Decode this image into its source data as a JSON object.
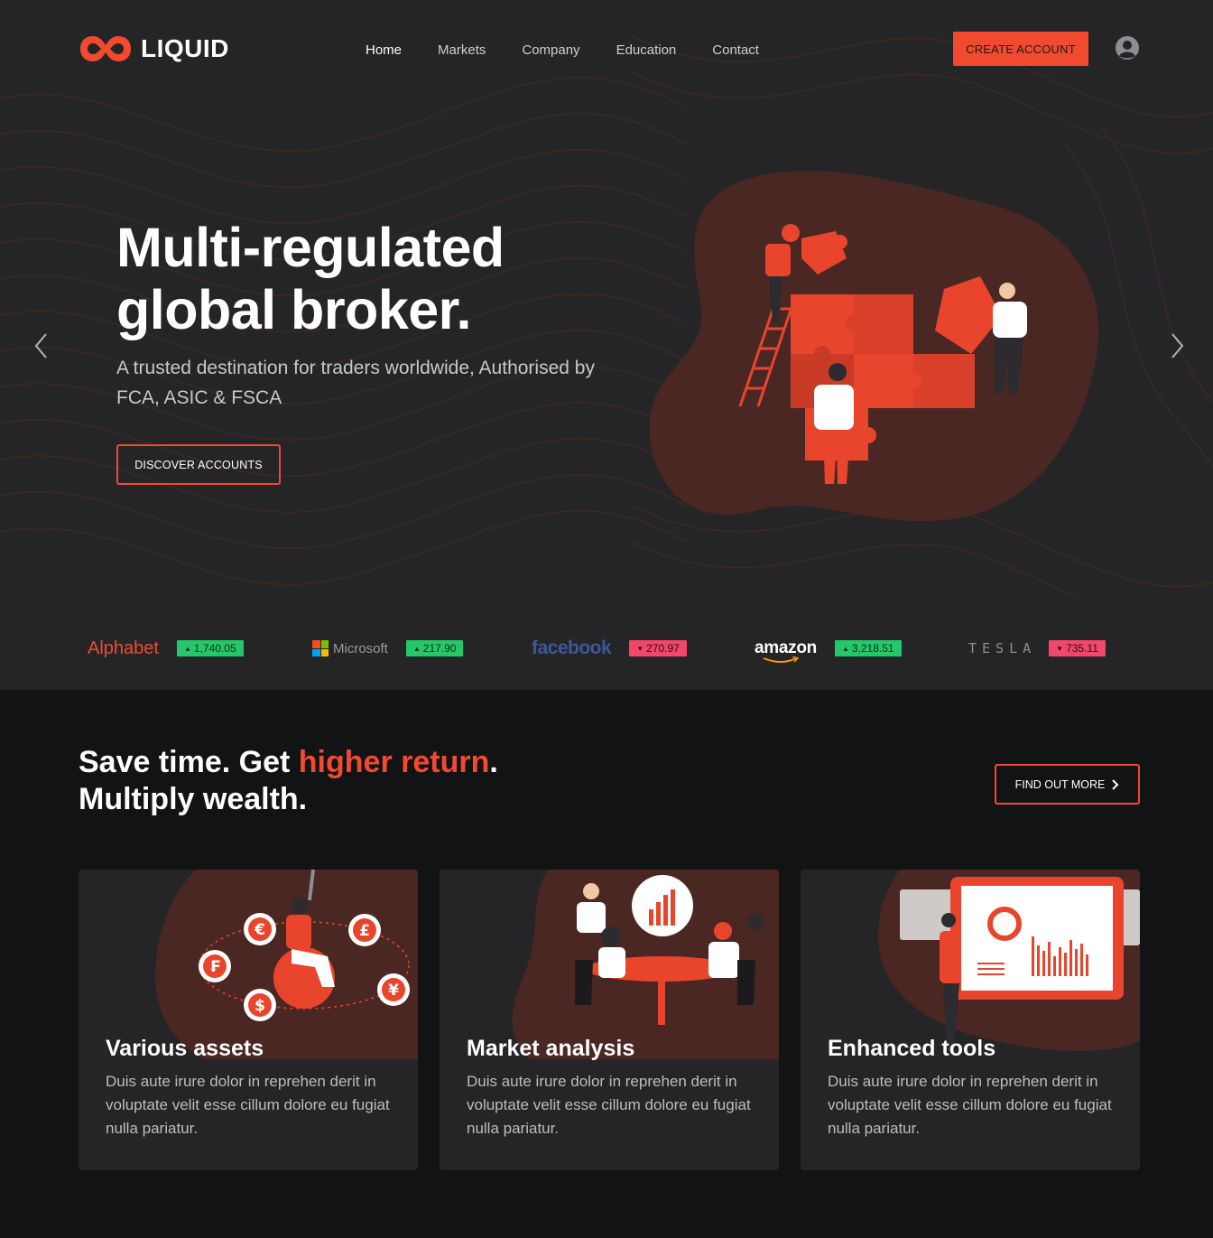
{
  "brand": {
    "name": "LIQUID",
    "accent": "#f24a2f"
  },
  "nav": {
    "links": [
      "Home",
      "Markets",
      "Company",
      "Education",
      "Contact"
    ],
    "active": "Home",
    "create_account": "CREATE ACCOUNT"
  },
  "hero": {
    "title_line1": "Multi-regulated",
    "title_line2": "global broker.",
    "subtitle": "A trusted destination for traders worldwide, Authorised by FCA, ASIC & FSCA",
    "cta": "DISCOVER ACCOUNTS"
  },
  "ticker": [
    {
      "company": "Alphabet",
      "value": "1,740.05",
      "direction": "up"
    },
    {
      "company": "Microsoft",
      "value": "217.90",
      "direction": "up"
    },
    {
      "company": "facebook",
      "value": "270.97",
      "direction": "down"
    },
    {
      "company": "amazon",
      "value": "3,218.51",
      "direction": "up"
    },
    {
      "company": "TESLA",
      "value": "735.11",
      "direction": "down"
    }
  ],
  "section": {
    "title_part1": "Save time. Get ",
    "title_highlight": "higher return",
    "title_part2": ".",
    "title_line2": "Multiply wealth.",
    "cta": "FIND OUT MORE"
  },
  "cards": [
    {
      "title": "Various assets",
      "text": "Duis aute irure dolor in reprehen derit in voluptate velit esse cillum dolore eu fugiat nulla pariatur."
    },
    {
      "title": "Market analysis",
      "text": "Duis aute irure dolor in reprehen derit in voluptate velit esse cillum dolore eu fugiat nulla pariatur."
    },
    {
      "title": "Enhanced tools",
      "text": "Duis aute irure dolor in reprehen derit in voluptate velit esse cillum dolore eu fugiat nulla pariatur."
    }
  ]
}
